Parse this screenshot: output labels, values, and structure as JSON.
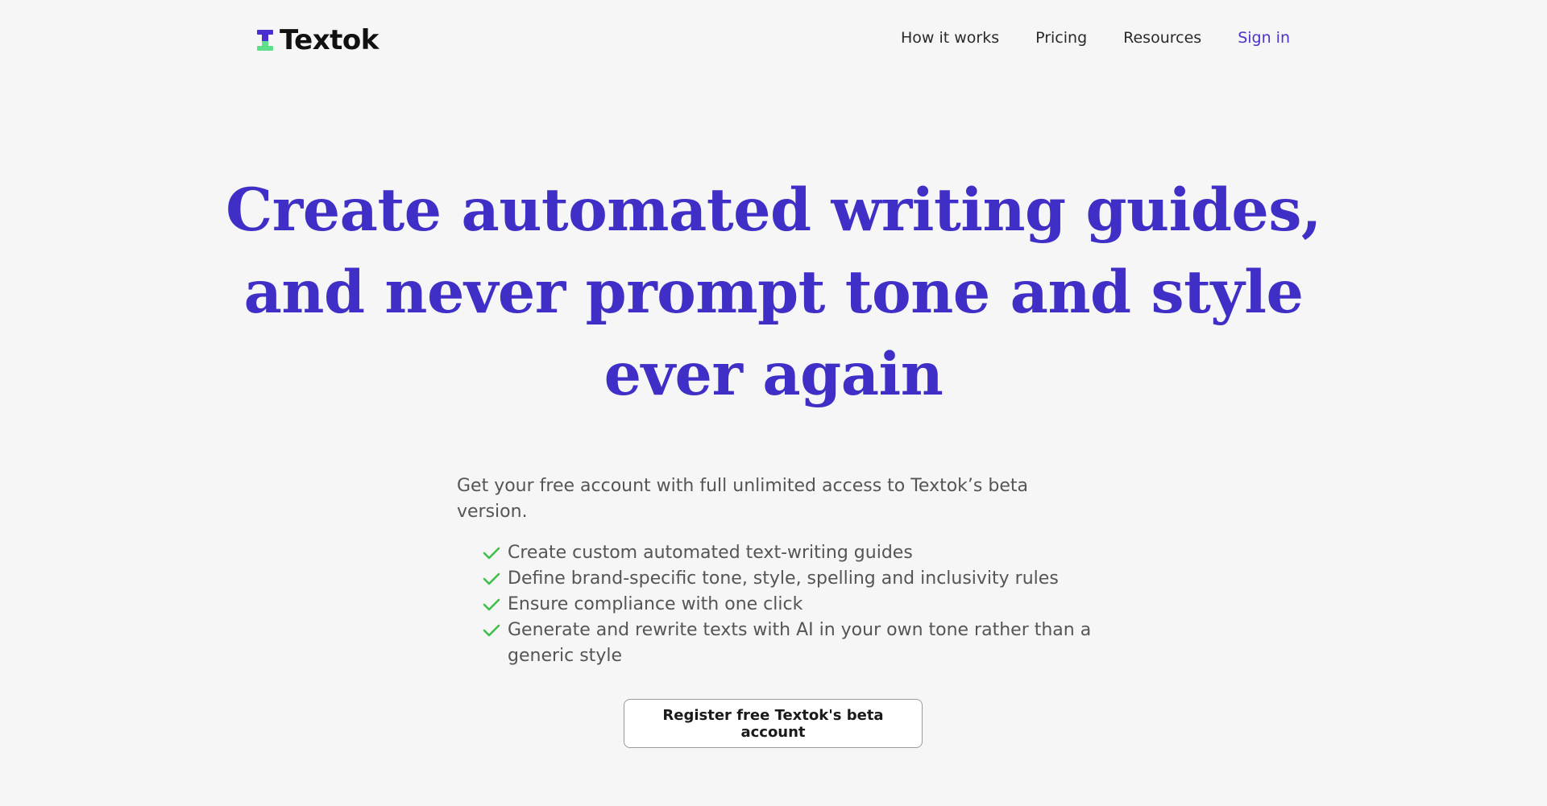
{
  "brand": {
    "name": "Textok",
    "primary_color": "#3f2fc7",
    "accent_color": "#5ee08a"
  },
  "nav": {
    "items": [
      {
        "label": "How it works"
      },
      {
        "label": "Pricing"
      },
      {
        "label": "Resources"
      },
      {
        "label": "Sign in"
      }
    ]
  },
  "hero": {
    "title_lines": [
      "Create automated writing guides,",
      "and never prompt tone and style",
      "ever again"
    ],
    "intro": "Get your free account with full unlimited access to Textok’s beta version.",
    "features": [
      "Create custom automated text-writing guides",
      "Define brand-specific tone, style, spelling and inclusivity rules",
      "Ensure compliance with one click",
      "Generate and rewrite texts with AI in your own tone rather than a generic style"
    ],
    "feature_icon": "check-icon",
    "check_color": "#3fbf4a",
    "cta_label": "Register free Textok's beta account"
  }
}
